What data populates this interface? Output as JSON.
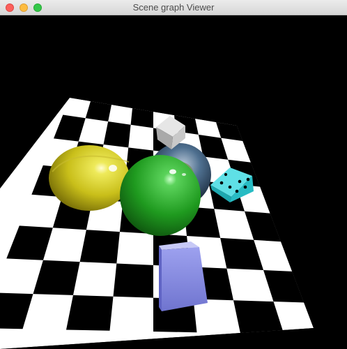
{
  "window": {
    "title": "Scene graph Viewer",
    "controls": {
      "close_color": "#fc605c",
      "minimize_color": "#fdbc40",
      "zoom_color": "#34c84a"
    }
  },
  "scene": {
    "background": "#000000",
    "floor": {
      "pattern": "checkerboard",
      "colors": [
        "#ffffff",
        "#000000"
      ]
    },
    "objects": [
      {
        "name": "yellow-sphere",
        "color": "#d8cc22"
      },
      {
        "name": "green-sphere",
        "color": "#1f9a1f"
      },
      {
        "name": "earth-sphere",
        "color": "#3a5c80"
      },
      {
        "name": "gray-cube",
        "color": "#b8b8b8"
      },
      {
        "name": "cyan-dice",
        "color": "#2ecdd6"
      },
      {
        "name": "blue-box",
        "color": "#8a8fe0"
      }
    ]
  }
}
